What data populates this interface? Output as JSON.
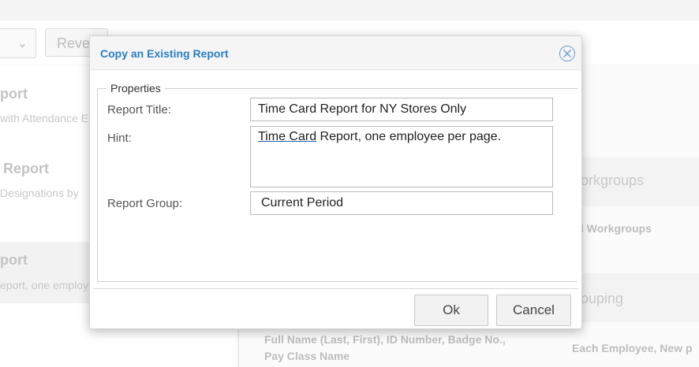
{
  "background": {
    "revert_button": "Reve",
    "left_cards": [
      {
        "title": "port",
        "subtitle": "with Attendance E"
      },
      {
        "title": "Report",
        "subtitle": "Designations by"
      },
      {
        "title": "port",
        "subtitle": "eport, one employ"
      }
    ],
    "right": {
      "workgroups_heading": "orkgroups",
      "workgroups_value": "l Workgroups",
      "grouping_heading": "ouping",
      "sort_value_line1": "Full Name (Last, First), ID Number, Badge No.,",
      "sort_value_line2": "Pay Class Name",
      "grouping_value": "Each Employee, New p"
    }
  },
  "dialog": {
    "title": "Copy an Existing Report",
    "fieldset_legend": "Properties",
    "fields": {
      "report_title_label": "Report Title:",
      "report_title_value": "Time Card Report for NY Stores Only",
      "hint_label": "Hint:",
      "hint_underlined": "Time Card",
      "hint_rest": " Report, one employee per page.",
      "report_group_label": "Report Group:",
      "report_group_value": "Current Period"
    },
    "buttons": {
      "ok": "Ok",
      "cancel": "Cancel"
    }
  },
  "colors": {
    "accent": "#2a7ec4",
    "close_icon": "#6a9fd0"
  }
}
